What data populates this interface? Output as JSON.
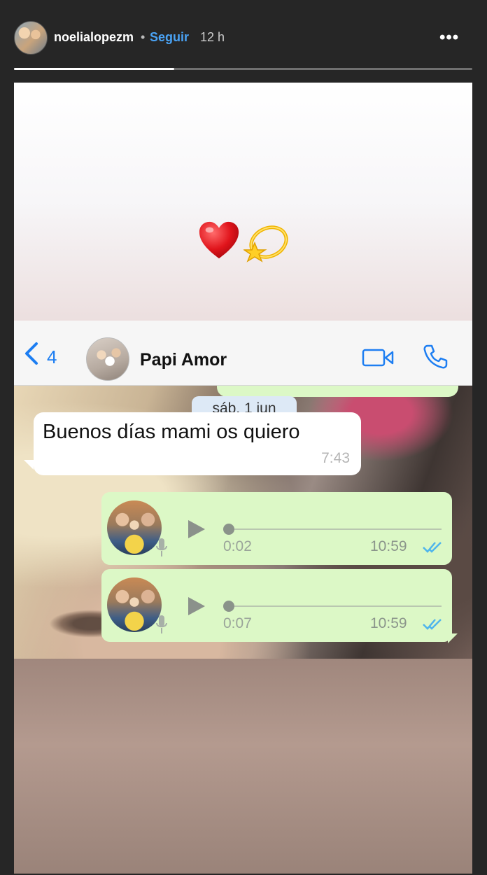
{
  "story": {
    "username": "noelialopezm",
    "separator": "•",
    "follow_label": "Seguir",
    "time_ago": "12 h",
    "more_label": "•••",
    "progress": 0.35
  },
  "whatsapp": {
    "back_count": "4",
    "contact_name": "Papi Amor",
    "date_label": "sáb, 1 jun",
    "incoming": {
      "text": "Buenos días mami os quiero",
      "time": "7:43"
    },
    "voice_notes": [
      {
        "duration": "0:02",
        "time": "10:59"
      },
      {
        "duration": "0:07",
        "time": "10:59"
      }
    ]
  },
  "icons": {
    "heart": "red-heart-icon",
    "dizzy": "dizzy-star-icon",
    "back": "chevron-left-icon",
    "video": "video-call-icon",
    "phone": "phone-call-icon",
    "play": "play-icon",
    "mic": "microphone-icon",
    "read": "double-check-icon"
  },
  "colors": {
    "follow": "#4aa3f5",
    "wa_accent": "#1d7ef2",
    "outgoing_bubble": "#dcf8c6",
    "read_ticks": "#4fb5ec"
  }
}
